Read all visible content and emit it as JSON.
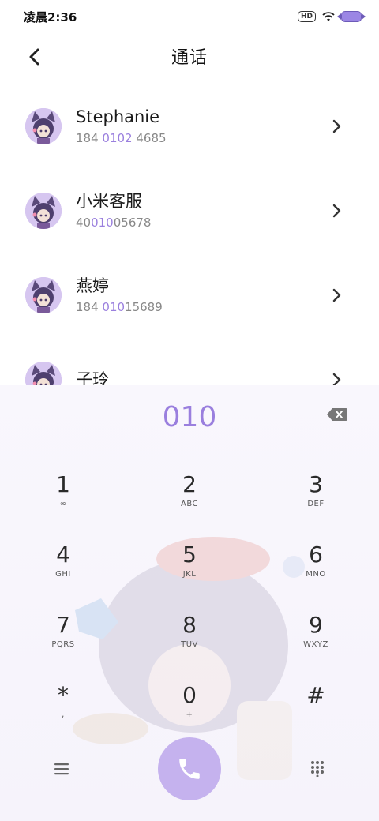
{
  "status_bar": {
    "time": "凌晨2:36",
    "hd_label": "HD",
    "icons": [
      "hd-icon",
      "wifi-icon",
      "battery-icon"
    ]
  },
  "header": {
    "title": "通话",
    "back_icon": "chevron-left-icon"
  },
  "contacts": [
    {
      "name": "Stephanie",
      "number_pre": "184 ",
      "number_hl": "0102",
      "number_post": " 4685"
    },
    {
      "name": "小米客服",
      "number_pre": "40",
      "number_hl": "010",
      "number_post": "05678"
    },
    {
      "name": "燕婷",
      "number_pre": "184 ",
      "number_hl": "010",
      "number_post": "15689"
    },
    {
      "name": "子玲",
      "number_pre": "",
      "number_hl": "",
      "number_post": ""
    }
  ],
  "dialer": {
    "input_value": "010",
    "keys": [
      {
        "digit": "1",
        "sub": "∞"
      },
      {
        "digit": "2",
        "sub": "ABC"
      },
      {
        "digit": "3",
        "sub": "DEF"
      },
      {
        "digit": "4",
        "sub": "GHI"
      },
      {
        "digit": "5",
        "sub": "JKL"
      },
      {
        "digit": "6",
        "sub": "MNO"
      },
      {
        "digit": "7",
        "sub": "PQRS"
      },
      {
        "digit": "8",
        "sub": "TUV"
      },
      {
        "digit": "9",
        "sub": "WXYZ"
      },
      {
        "digit": "*",
        "sub": ","
      },
      {
        "digit": "0",
        "sub": "+"
      },
      {
        "digit": "#",
        "sub": ""
      }
    ]
  },
  "colors": {
    "accent": "#9a7fde",
    "call_button": "#c5b2ee"
  }
}
